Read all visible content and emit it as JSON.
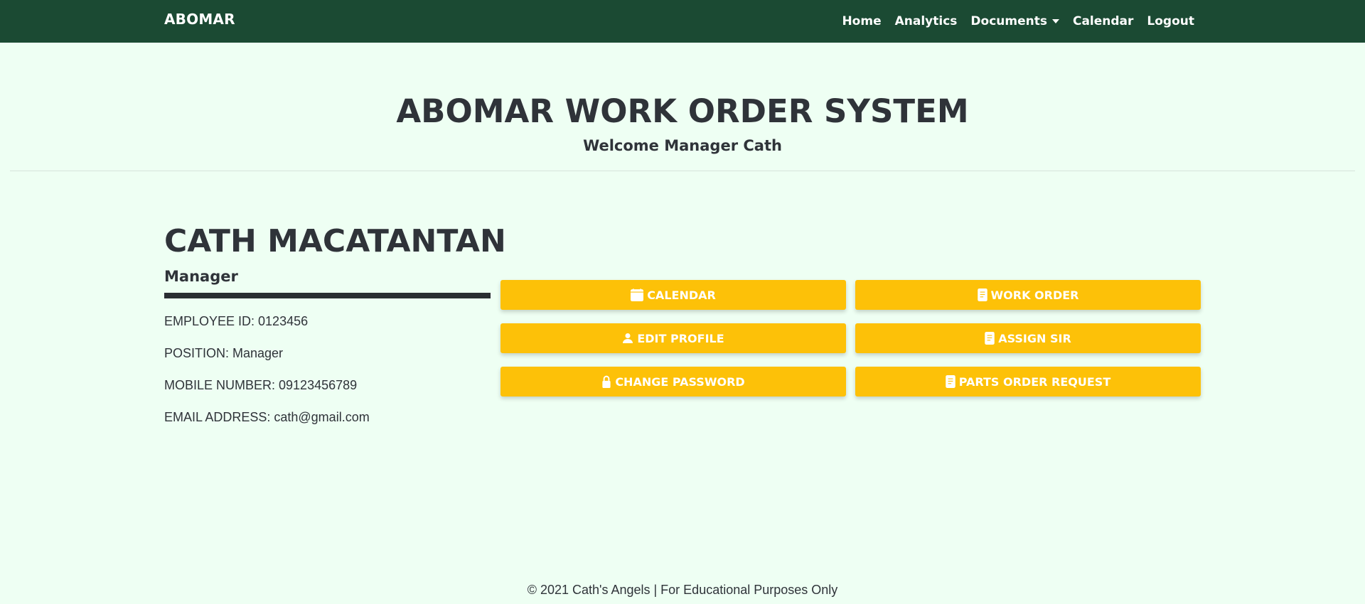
{
  "navbar": {
    "brand": "ABOMAR",
    "links": {
      "home": "Home",
      "analytics": "Analytics",
      "documents": "Documents",
      "calendar": "Calendar",
      "logout": "Logout"
    }
  },
  "header": {
    "title": "ABOMAR WORK ORDER SYSTEM",
    "subtitle": "Welcome Manager Cath"
  },
  "profile": {
    "name": "CATH MACATANTAN",
    "role": "Manager",
    "employee_id": "EMPLOYEE ID: 0123456",
    "position": "POSITION: Manager",
    "mobile": "MOBILE NUMBER: 09123456789",
    "email": "EMAIL ADDRESS: cath@gmail.com"
  },
  "actions": {
    "calendar": {
      "label": "CALENDAR",
      "icon": "calendar-icon"
    },
    "work_order": {
      "label": "WORK ORDER",
      "icon": "document-icon"
    },
    "edit_profile": {
      "label": "EDIT PROFILE",
      "icon": "person-icon"
    },
    "assign_sir": {
      "label": "ASSIGN SIR",
      "icon": "document-icon"
    },
    "change_password": {
      "label": "CHANGE PASSWORD",
      "icon": "lock-icon"
    },
    "parts_order_request": {
      "label": "PARTS ORDER REQUEST",
      "icon": "document-icon"
    }
  },
  "footer": {
    "text": "© 2021 Cath's Angels | For Educational Purposes Only"
  },
  "colors": {
    "navbar": "#1b4a33",
    "background": "#eefff3",
    "button": "#fdc108",
    "text": "#2f3339"
  }
}
